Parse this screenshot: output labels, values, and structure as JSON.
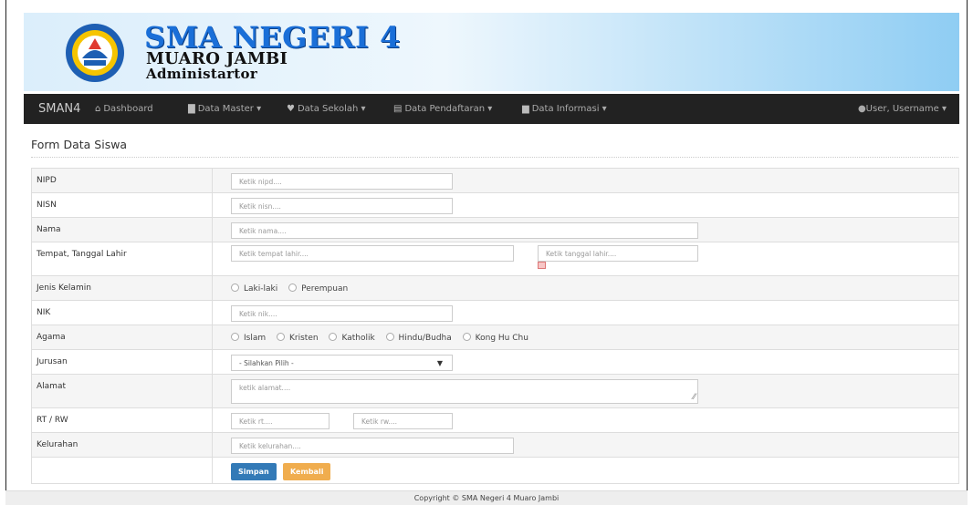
{
  "header": {
    "school_name": "SMA NEGERI 4",
    "location": "MUARO JAMBI",
    "role": "Administartor"
  },
  "navbar": {
    "brand": "SMAN4",
    "items": [
      {
        "label": "Dashboard",
        "icon": "home-icon"
      },
      {
        "label": "Data Master ▾",
        "icon": "book-icon"
      },
      {
        "label": "Data Sekolah ▾",
        "icon": "map-marker-icon"
      },
      {
        "label": "Data Pendaftaran ▾",
        "icon": "list-icon"
      },
      {
        "label": "Data Informasi ▾",
        "icon": "file-icon"
      }
    ],
    "user": "User, Username ▾"
  },
  "form": {
    "title": "Form Data Siswa",
    "rows": {
      "nipd": {
        "label": "NIPD",
        "placeholder": "Ketik nipd...."
      },
      "nisn": {
        "label": "NISN",
        "placeholder": "Ketik nisn...."
      },
      "nama": {
        "label": "Nama",
        "placeholder": "Ketik nama...."
      },
      "ttl": {
        "label": "Tempat, Tanggal Lahir",
        "placeholder_tempat": "Ketik tempat lahir....",
        "placeholder_tanggal": "Ketik tanggal lahir...."
      },
      "jk": {
        "label": "Jenis Kelamin",
        "options": [
          "Laki-laki",
          "Perempuan"
        ]
      },
      "nik": {
        "label": "NIK",
        "placeholder": "Ketik nik...."
      },
      "agama": {
        "label": "Agama",
        "options": [
          "Islam",
          "Kristen",
          "Katholik",
          "Hindu/Budha",
          "Kong Hu Chu"
        ]
      },
      "jurusan": {
        "label": "Jurusan",
        "selected": "- Silahkan Pilih -"
      },
      "alamat": {
        "label": "Alamat",
        "placeholder": "ketik alamat...."
      },
      "rtrw": {
        "label": "RT / RW",
        "placeholder_rt": "Ketik rt....",
        "placeholder_rw": "Ketik rw...."
      },
      "kelurahan": {
        "label": "Kelurahan",
        "placeholder": "Ketik kelurahan...."
      }
    },
    "buttons": {
      "save": "Simpan",
      "back": "Kembali"
    }
  },
  "footer": {
    "text": "Copyright © SMA Negeri 4 Muaro Jambi"
  },
  "colors": {
    "navbar": "#222222",
    "primary": "#337ab7",
    "warning": "#f0ad4e"
  }
}
